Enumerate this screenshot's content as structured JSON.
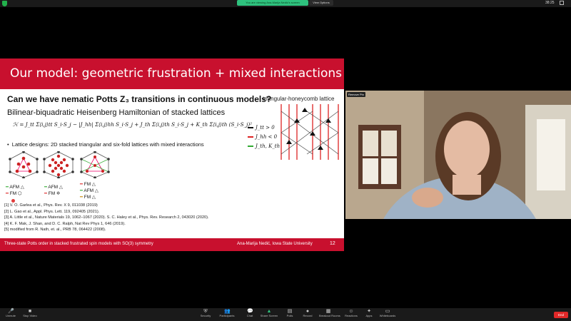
{
  "topbar": {
    "share_banner": "You are viewing Ana-Marija Nedić's screen",
    "view_options": "View Options",
    "clock": "38:25"
  },
  "slide": {
    "title": "Our model: geometric frustration + mixed interactions",
    "question": "Can we have nematic Potts Z₃ transitions in continuous models?",
    "lattice_label": "triangular-honeycomb lattice",
    "ham_title": "Bilinear-biquadratic Heisenberg Hamiltonian of stacked lattices",
    "hamiltonian": "ℋ = J_tt Σ⟨i,j⟩tt S_i·S_j − |J_hh| Σ⟨i,j⟩hh S_i·S_j + J_th Σ⟨i,j⟩th S_i·S_j + K_th Σ⟨i,j⟩th (S_i·S_j)²",
    "legend": [
      "J_tt > 0",
      "J_hh < 0",
      "J_th, K_th"
    ],
    "bullet": "Lattice designs: 2D stacked triangular and six-fold lattices with mixed interactions",
    "lattice_notes": [
      [
        "AFM △",
        "FM ⬡"
      ],
      [
        "AFM △",
        "FM ✡"
      ],
      [
        "FM △",
        "AFM △",
        "FM △"
      ]
    ],
    "refs": [
      "[1] V. O. Garlea et al., Phys. Rev. X 9, 011038 (2019)",
      "[2] L. Gao et al., Appl. Phys. Lett. 119, 092405 (2021).",
      "[3] A. Little et al., Nature Materials 19, 1062–1067 (2020). S. C. Haley et al., Phys. Rev. Research 2, 043020 (2020).",
      "[4] K. F. Mak, J. Shan, and D. C. Ralph, Nat Rev Phys 1, 646 (2019).",
      "[5] modified from R. Nath, et. al., PRB 78, 064422 (2008)."
    ],
    "footer_left": "Three-state Potts order in stacked frustrated spin models with SO(3) symmetry",
    "footer_right": "Ana-Marija Nedić, Iowa State University",
    "page_number": "12"
  },
  "video": {
    "label": "Remove Pin"
  },
  "toolbar": {
    "items": [
      {
        "label": "Unmute",
        "icon": "mic-muted-icon",
        "glyph": "🎤"
      },
      {
        "label": "Stop Video",
        "icon": "video-icon",
        "glyph": "■"
      },
      {
        "label": "Security",
        "icon": "shield-icon",
        "glyph": "⛨"
      },
      {
        "label": "Participants",
        "icon": "participants-icon",
        "glyph": "👥"
      },
      {
        "label": "Chat",
        "icon": "chat-icon",
        "glyph": "💬"
      },
      {
        "label": "Share Screen",
        "icon": "share-screen-icon",
        "glyph": "▲"
      },
      {
        "label": "Polls",
        "icon": "polls-icon",
        "glyph": "▤"
      },
      {
        "label": "Record",
        "icon": "record-icon",
        "glyph": "●"
      },
      {
        "label": "Breakout Rooms",
        "icon": "breakout-icon",
        "glyph": "▦"
      },
      {
        "label": "Reactions",
        "icon": "reactions-icon",
        "glyph": "☺"
      },
      {
        "label": "Apps",
        "icon": "apps-icon",
        "glyph": "✦"
      },
      {
        "label": "Whiteboards",
        "icon": "whiteboard-icon",
        "glyph": "▭"
      }
    ],
    "end_label": "End"
  },
  "colors": {
    "slide_accent": "#c8102e",
    "share_green": "#2ec27e",
    "end_red": "#e02828"
  }
}
